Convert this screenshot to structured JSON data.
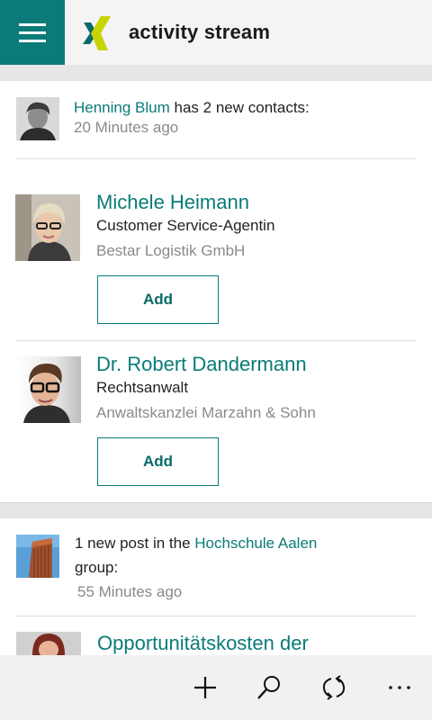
{
  "header": {
    "title": "activity stream"
  },
  "feed": {
    "contacts_event": {
      "actor": "Henning Blum",
      "text": "has 2 new contacts:",
      "time": "20 Minutes ago"
    },
    "contacts": [
      {
        "name": "Michele Heimann",
        "role": "Customer Service-Agentin",
        "company": "Bestar Logistik GmbH",
        "button": "Add"
      },
      {
        "name": "Dr. Robert Dandermann",
        "role": "Rechtsanwalt",
        "company": "Anwaltskanzlei Marzahn & Sohn",
        "button": "Add"
      }
    ],
    "group_event": {
      "prefix": "1 new post in the",
      "group": "Hochschule Aalen",
      "suffix": "group:",
      "time": "55 Minutes ago"
    },
    "next_post": {
      "title": "Opportunitätskosten der"
    }
  },
  "appbar": {
    "icons": [
      "add-icon",
      "search-icon",
      "refresh-icon",
      "more-icon"
    ]
  },
  "colors": {
    "accent": "#0a7b79",
    "logo_dark": "#0a6a68",
    "logo_light": "#c8d400"
  }
}
